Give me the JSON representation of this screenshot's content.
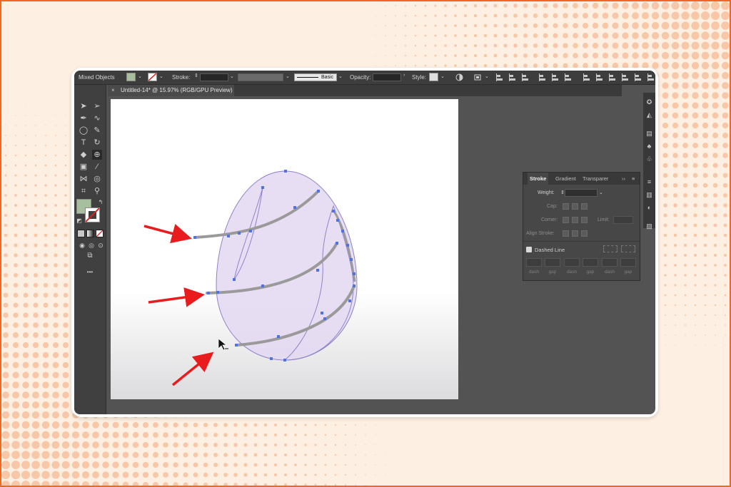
{
  "control_bar": {
    "selection_label": "Mixed Objects",
    "fill_color": "#a7bf9f",
    "stroke_label": "Stroke:",
    "stroke_value": "",
    "brush_label": "Basic",
    "opacity_label": "Opacity:",
    "opacity_value": "",
    "style_label": "Style:"
  },
  "document_tab": {
    "close_glyph": "×",
    "title": "Untitled-14* @ 15.97% (RGB/GPU Preview)"
  },
  "toolbar": {
    "fill_color": "#a7bf9f",
    "more_glyph": "•••",
    "tools": [
      "selection-tool",
      "direct-selection-tool",
      "pen-tool",
      "curvature-tool",
      "ellipse-tool",
      "pencil-tool",
      "type-tool",
      "rotate-tool",
      "eraser-tool",
      "shape-builder-tool",
      "gradient-tool",
      "eyedropper-tool",
      "width-tool",
      "blend-tool",
      "artboard-tool",
      "zoom-tool"
    ]
  },
  "canvas": {
    "egg_fill": "#e3d8f2",
    "egg_stroke": "#8f83c8",
    "stripe_color": "#9a9a9a",
    "anchor_color": "#4f73e3",
    "arrow_color": "#e81c1c"
  },
  "stroke_panel": {
    "tabs": [
      "Stroke",
      "Gradient",
      "Transparer"
    ],
    "menu_glyph": "≡",
    "collapse_glyph": "››",
    "weight_label": "Weight:",
    "cap_label": "Cap:",
    "corner_label": "Corner:",
    "limit_label": "Limit:",
    "align_label": "Align Stroke:",
    "dashed_label": "Dashed Line",
    "dash_fields": [
      "dash",
      "gap",
      "dash",
      "gap",
      "dash",
      "gap"
    ]
  },
  "colors": {
    "frame_accent": "#f26522",
    "background": "#fdf0e2",
    "dot_color": "#f8c7a8"
  }
}
